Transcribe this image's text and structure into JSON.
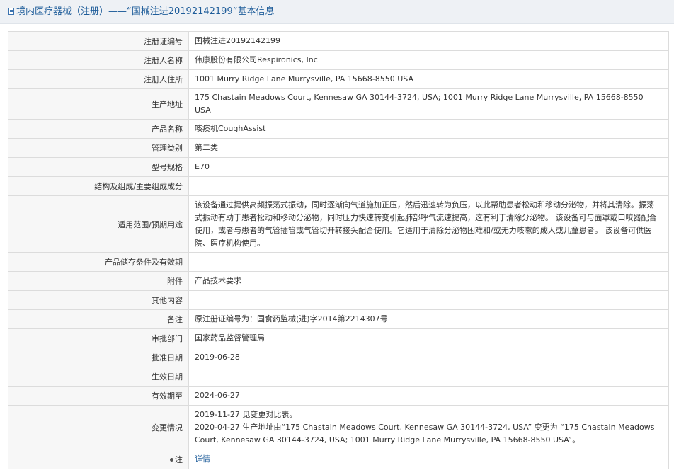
{
  "header": {
    "title": "境内医疗器械（注册）——“国械注进20192142199”基本信息"
  },
  "rows": {
    "reg_no": {
      "label": "注册证编号",
      "value": "国械注进20192142199"
    },
    "registrant_name": {
      "label": "注册人名称",
      "value": "伟康股份有限公司Respironics, Inc"
    },
    "registrant_address": {
      "label": "注册人住所",
      "value": "1001 Murry Ridge Lane Murrysville, PA 15668-8550 USA"
    },
    "production_address": {
      "label": "生产地址",
      "value": "175 Chastain Meadows Court, Kennesaw GA 30144-3724, USA; 1001 Murry Ridge Lane Murrysville, PA 15668-8550 USA"
    },
    "product_name": {
      "label": "产品名称",
      "value": "咳痰机CoughAssist"
    },
    "management_class": {
      "label": "管理类别",
      "value": "第二类"
    },
    "model_spec": {
      "label": "型号规格",
      "value": "E70"
    },
    "structure": {
      "label": "结构及组成/主要组成成分",
      "value": ""
    },
    "intended_use": {
      "label": "适用范围/预期用途",
      "value": "该设备通过提供高频振荡式振动，同时逐渐向气道施加正压，然后迅速转为负压，以此帮助患者松动和移动分泌物，并将其清除。振荡式振动有助于患者松动和移动分泌物，同时压力快速转变引起肺部呼气流速提高，这有利于清除分泌物。 该设备可与面罩或口咬器配合使用，或者与患者的气管插管或气管切开转接头配合使用。它适用于清除分泌物困难和/或无力咳嗽的成人或儿童患者。 该设备可供医院、医疗机构使用。"
    },
    "storage": {
      "label": "产品储存条件及有效期",
      "value": ""
    },
    "attachment": {
      "label": "附件",
      "value": "产品技术要求"
    },
    "other": {
      "label": "其他内容",
      "value": ""
    },
    "remarks": {
      "label": "备注",
      "value": "原注册证编号为：国食药监械(进)字2014第2214307号"
    },
    "approval_dept": {
      "label": "审批部门",
      "value": "国家药品监督管理局"
    },
    "approval_date": {
      "label": "批准日期",
      "value": "2019-06-28"
    },
    "effective_date": {
      "label": "生效日期",
      "value": ""
    },
    "valid_until": {
      "label": "有效期至",
      "value": "2024-06-27"
    },
    "changes": {
      "label": "变更情况",
      "line1": "2019-11-27 见变更对比表。",
      "line2": "2020-04-27 生产地址由“175 Chastain Meadows Court, Kennesaw GA 30144-3724, USA” 变更为 “175 Chastain Meadows Court, Kennesaw GA 30144-3724, USA; 1001 Murry Ridge Lane Murrysville, PA 15668-8550 USA”。"
    },
    "note": {
      "label": "注",
      "link": "详情"
    }
  }
}
